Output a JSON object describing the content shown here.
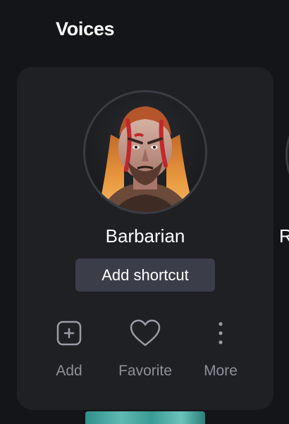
{
  "section": {
    "title": "Voices"
  },
  "card": {
    "name": "Barbarian",
    "shortcut_label": "Add shortcut",
    "actions": [
      {
        "label": "Add",
        "icon": "plus-square-icon"
      },
      {
        "label": "Favorite",
        "icon": "heart-icon"
      },
      {
        "label": "More",
        "icon": "more-vertical-icon"
      }
    ]
  },
  "next_card": {
    "name_fragment": "R"
  },
  "colors": {
    "background": "#141518",
    "card": "#1f2024",
    "button": "#3b3e49",
    "muted_text": "#8e909a"
  }
}
